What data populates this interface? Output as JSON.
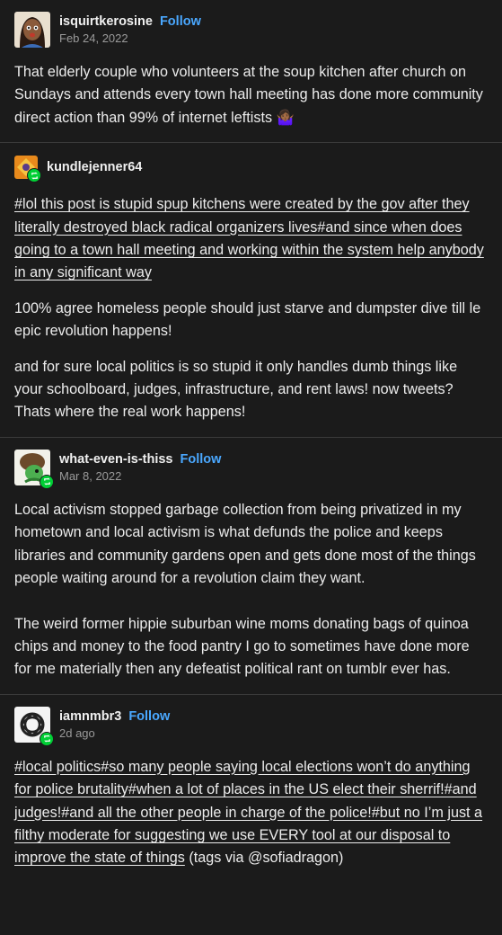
{
  "posts": [
    {
      "username": "isquirtkerosine",
      "follow_label": "Follow",
      "date": "Feb 24, 2022",
      "avatar_icon": "cartoon-woman-avatar",
      "paragraphs": [
        "That elderly couple who volunteers at the soup kitchen after church on Sundays and attends every town hall meeting has done more community direct action than 99% of internet leftists 🤷🏾‍♀️"
      ]
    },
    {
      "username": "kundlejenner64",
      "avatar_icon": "orange-pattern-avatar",
      "tags_text": "#lol this post is stupid spup kitchens were created by the gov after they literally destroyed black radical organizers lives#and since when does going to a town hall meeting and working within the system help anybody in any significant way",
      "paragraphs": [
        "100% agree homeless people should just starve and dumpster dive till le epic revolution happens!",
        "and for sure local politics is so stupid it only handles dumb things like your schoolboard, judges, infrastructure, and rent laws! now tweets? Thats where the real work happens!"
      ]
    },
    {
      "username": "what-even-is-thiss",
      "follow_label": "Follow",
      "date": "Mar 8, 2022",
      "avatar_icon": "green-creature-avatar",
      "paragraphs": [
        "Local activism stopped garbage collection from being privatized in my hometown and local activism is what defunds the police and keeps libraries and community gardens open and gets done most of the things people waiting around for a revolution claim they want.",
        "The weird former hippie suburban wine moms donating bags of quinoa chips and money to the food pantry I go to sometimes have done more for me materially then any defeatist political rant on tumblr ever has."
      ]
    },
    {
      "username": "iamnmbr3",
      "follow_label": "Follow",
      "date": "2d ago",
      "avatar_icon": "celtic-knot-avatar",
      "tags_text": "#local politics#so many people saying local elections won’t do anything for police brutality#when a lot of places in the US elect their sherrif!#and judges!#and all the other people in charge of the police!#but no I’m just a filthy moderate for suggesting we use EVERY tool at our disposal to improve the state of things",
      "tags_suffix": " (tags via @sofiadragon)"
    }
  ],
  "colors": {
    "background": "#1b1b1b",
    "text": "#ececec",
    "follow": "#4aa8ff",
    "reblog_badge": "#00cf35"
  }
}
